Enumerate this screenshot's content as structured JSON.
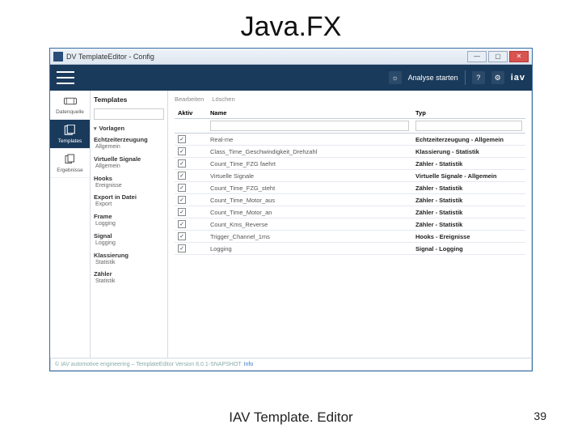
{
  "slide": {
    "title": "Java.FX",
    "caption": "IAV Template. Editor",
    "page": "39"
  },
  "window": {
    "title": "DV TemplateEditor - Config"
  },
  "topbar": {
    "analyse": "Analyse starten",
    "brand": "iav"
  },
  "rail": {
    "items": [
      {
        "label": "Datenquelle"
      },
      {
        "label": "Templates"
      },
      {
        "label": "Ergebnisse"
      }
    ]
  },
  "tree": {
    "title": "Templates",
    "filter_ph": "",
    "groups": [
      {
        "caret": "▾",
        "head": "Vorlagen",
        "item": ""
      },
      {
        "caret": "",
        "head": "Echtzeiterzeugung",
        "item": "Allgemein"
      },
      {
        "caret": "",
        "head": "Virtuelle Signale",
        "item": "Allgemein"
      },
      {
        "caret": "",
        "head": "Hooks",
        "item": "Ereignisse"
      },
      {
        "caret": "",
        "head": "Export in Datei",
        "item": "Export"
      },
      {
        "caret": "",
        "head": "Frame",
        "item": "Logging"
      },
      {
        "caret": "",
        "head": "Signal",
        "item": "Logging"
      },
      {
        "caret": "",
        "head": "Klassierung",
        "item": "Statistik"
      },
      {
        "caret": "",
        "head": "Zähler",
        "item": "Statistik"
      }
    ]
  },
  "toolbar": {
    "edit": "Bearbeiten",
    "delete": "Löschen"
  },
  "table": {
    "headers": {
      "active": "Aktiv",
      "name": "Name",
      "type": "Typ"
    },
    "rows": [
      {
        "name": "Real-me",
        "type": "Echtzeiterzeugung - Allgemein"
      },
      {
        "name": "Class_Time_Geschwindigkeit_Drehzahl",
        "type": "Klassierung - Statistik"
      },
      {
        "name": "Count_Time_FZG faehrt",
        "type": "Zähler - Statistik"
      },
      {
        "name": "Virtuelle Signale",
        "type": "Virtuelle Signale - Allgemein"
      },
      {
        "name": "Count_Time_FZG_steht",
        "type": "Zähler - Statistik"
      },
      {
        "name": "Count_Time_Motor_aus",
        "type": "Zähler - Statistik"
      },
      {
        "name": "Count_Time_Motor_an",
        "type": "Zähler - Statistik"
      },
      {
        "name": "Count_Kms_Reverse",
        "type": "Zähler - Statistik"
      },
      {
        "name": "Trigger_Channel_1ms",
        "type": "Hooks - Ereignisse"
      },
      {
        "name": "Logging",
        "type": "Signal - Logging"
      }
    ]
  },
  "footer": {
    "text": "© IAV automotive engineering – TemplateEditor Version 8.0.1-SNAPSHOT",
    "link": "Info"
  }
}
